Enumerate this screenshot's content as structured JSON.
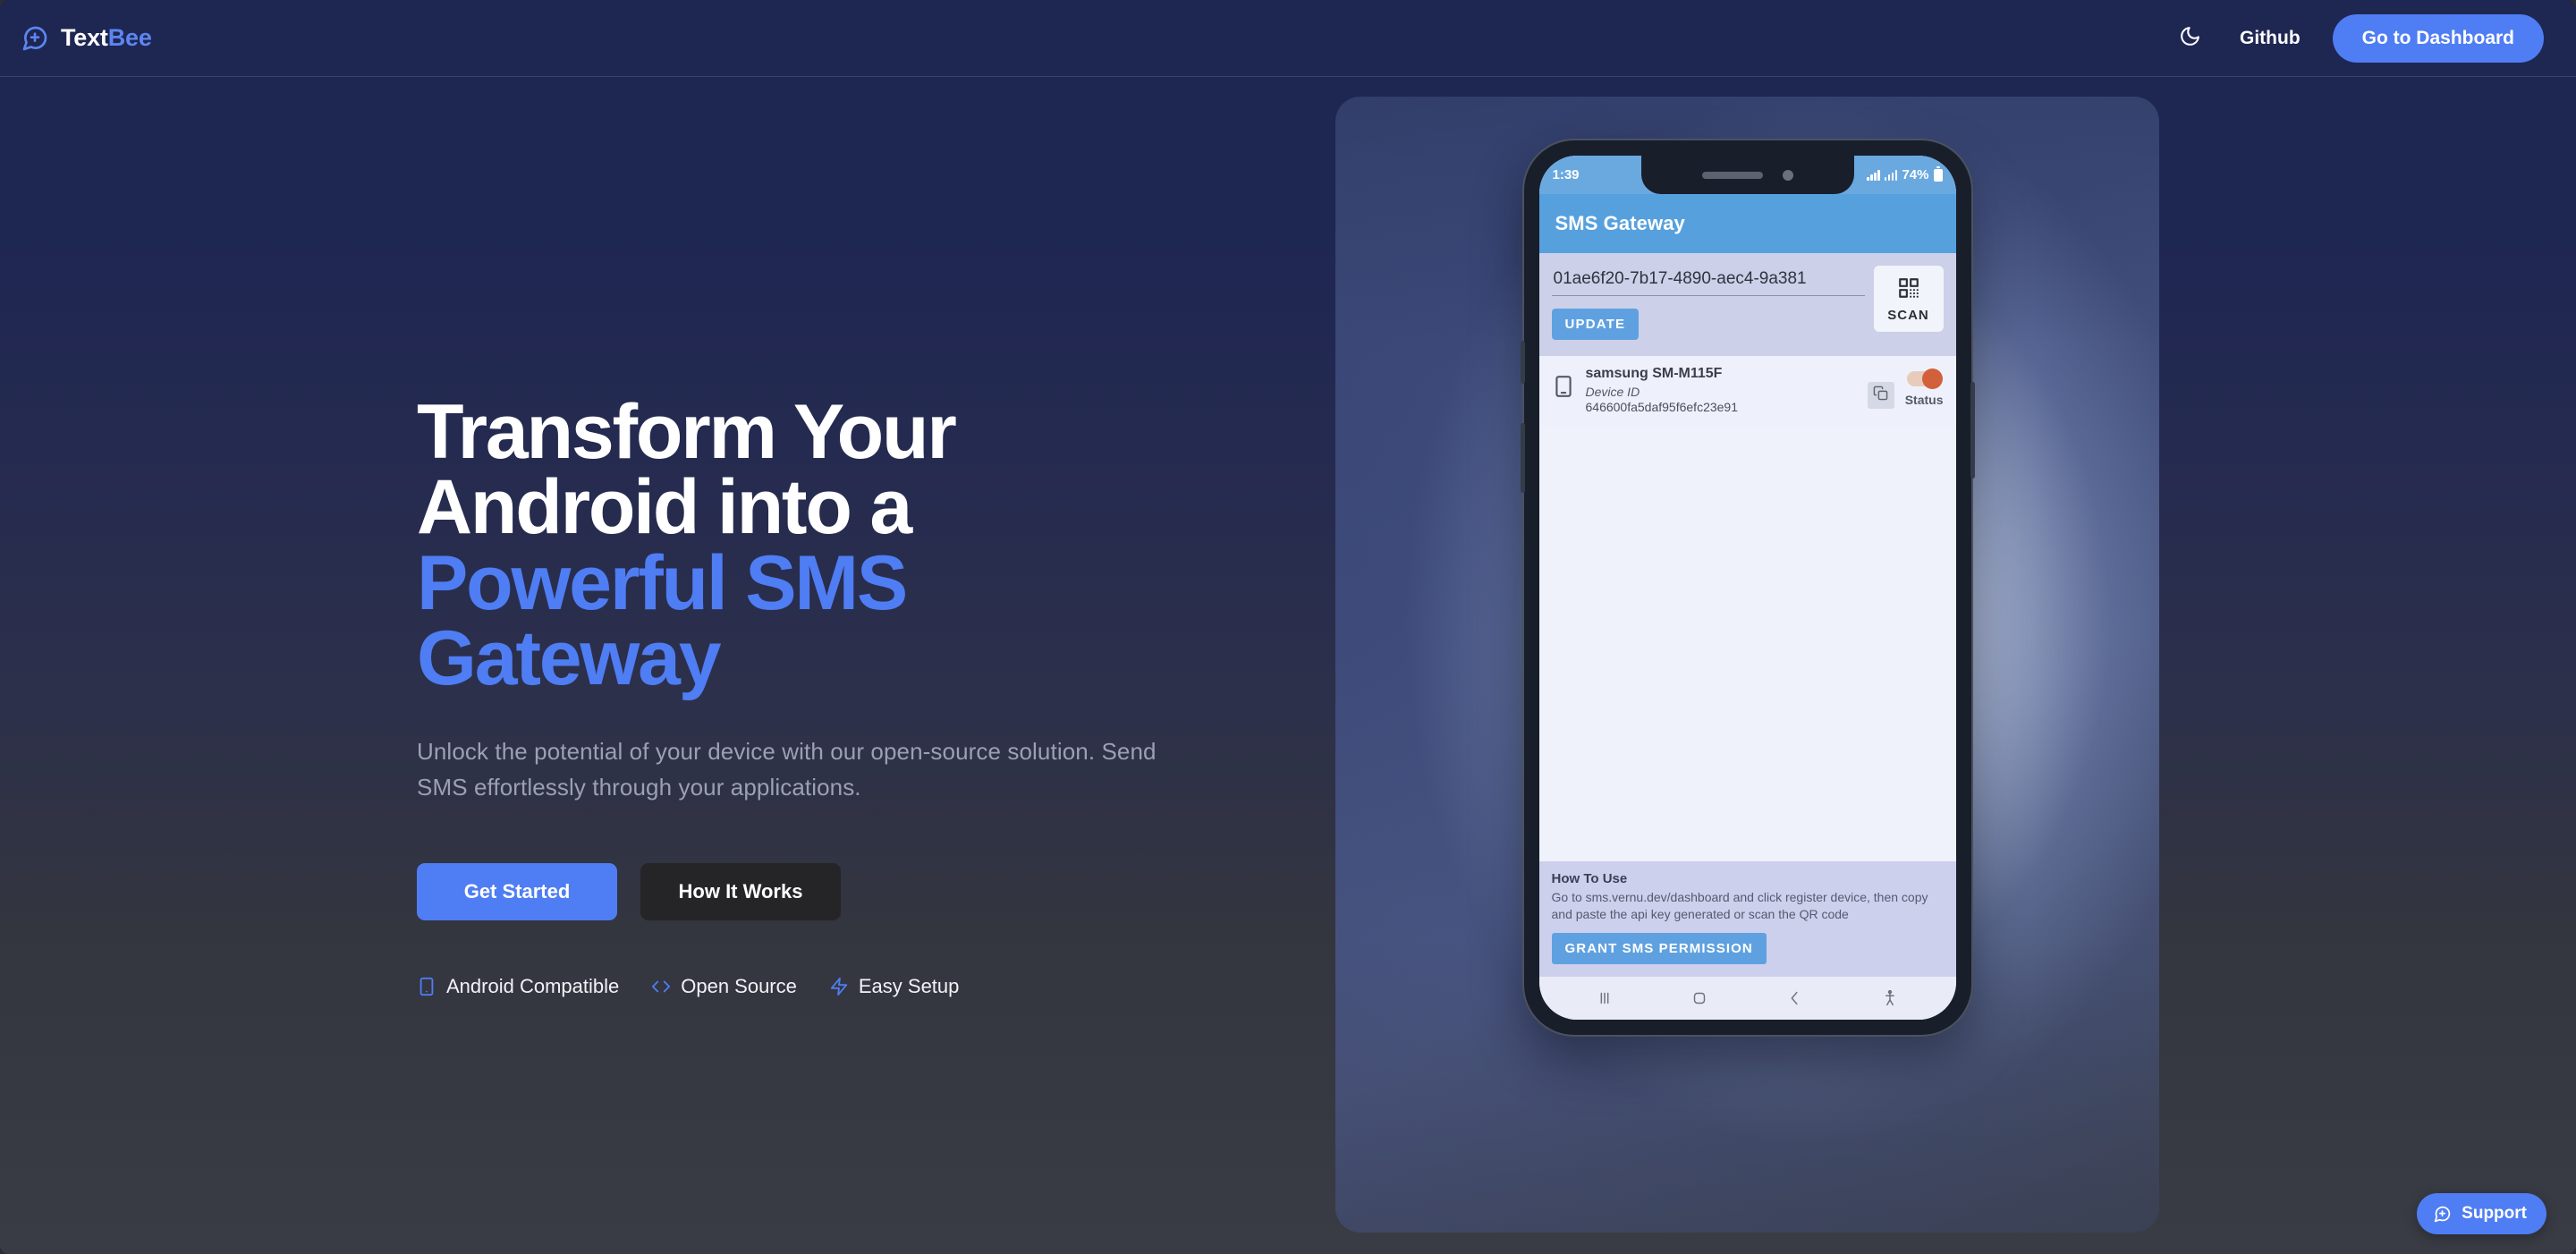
{
  "header": {
    "brand": {
      "name_primary": "Text",
      "name_accent": "Bee",
      "icon": "message-square-plus-icon"
    },
    "theme_toggle_icon": "moon-icon",
    "github_label": "Github",
    "dashboard_label": "Go to Dashboard"
  },
  "hero": {
    "headline_line1": "Transform Your",
    "headline_line2": "Android into a",
    "headline_accent1": "Powerful SMS",
    "headline_accent2": "Gateway",
    "subheadline": "Unlock the potential of your device with our open-source solution. Send SMS effortlessly through your applications.",
    "primary_button": "Get Started",
    "secondary_button": "How It Works",
    "features": [
      {
        "icon": "smartphone-icon",
        "label": "Android Compatible"
      },
      {
        "icon": "code-brackets-icon",
        "label": "Open Source"
      },
      {
        "icon": "lightning-bolt-icon",
        "label": "Easy Setup"
      }
    ]
  },
  "phone": {
    "status_bar": {
      "time": "1:39",
      "battery_percent": "74%"
    },
    "app_title": "SMS Gateway",
    "api_key_value": "01ae6f20-7b17-4890-aec4-9a381",
    "update_button": "UPDATE",
    "scan_button": {
      "icon": "qr-code-icon",
      "label": "SCAN"
    },
    "device": {
      "icon": "smartphone-icon",
      "name": "samsung SM-M115F",
      "id_label": "Device ID",
      "id_value": "646600fa5daf95f6efc23e91",
      "copy_icon": "copy-icon",
      "status_label": "Status",
      "status_on": true
    },
    "howto": {
      "title": "How To Use",
      "text": "Go to sms.vernu.dev/dashboard and click register device, then copy and paste the api key generated or scan the QR code",
      "grant_button": "GRANT SMS PERMISSION"
    },
    "nav_bar": [
      "recents-icon",
      "home-icon",
      "back-icon",
      "accessibility-icon"
    ]
  },
  "support": {
    "icon": "message-square-plus-icon",
    "label": "Support"
  },
  "colors": {
    "accent_blue": "#4f7df3",
    "brand_blue": "#5d85f0",
    "bg_navy": "#1e2652",
    "bg_gray": "#3a3c45",
    "secondary_btn": "#252527",
    "android_blue": "#57a0de",
    "status_orange": "#d2603a"
  }
}
